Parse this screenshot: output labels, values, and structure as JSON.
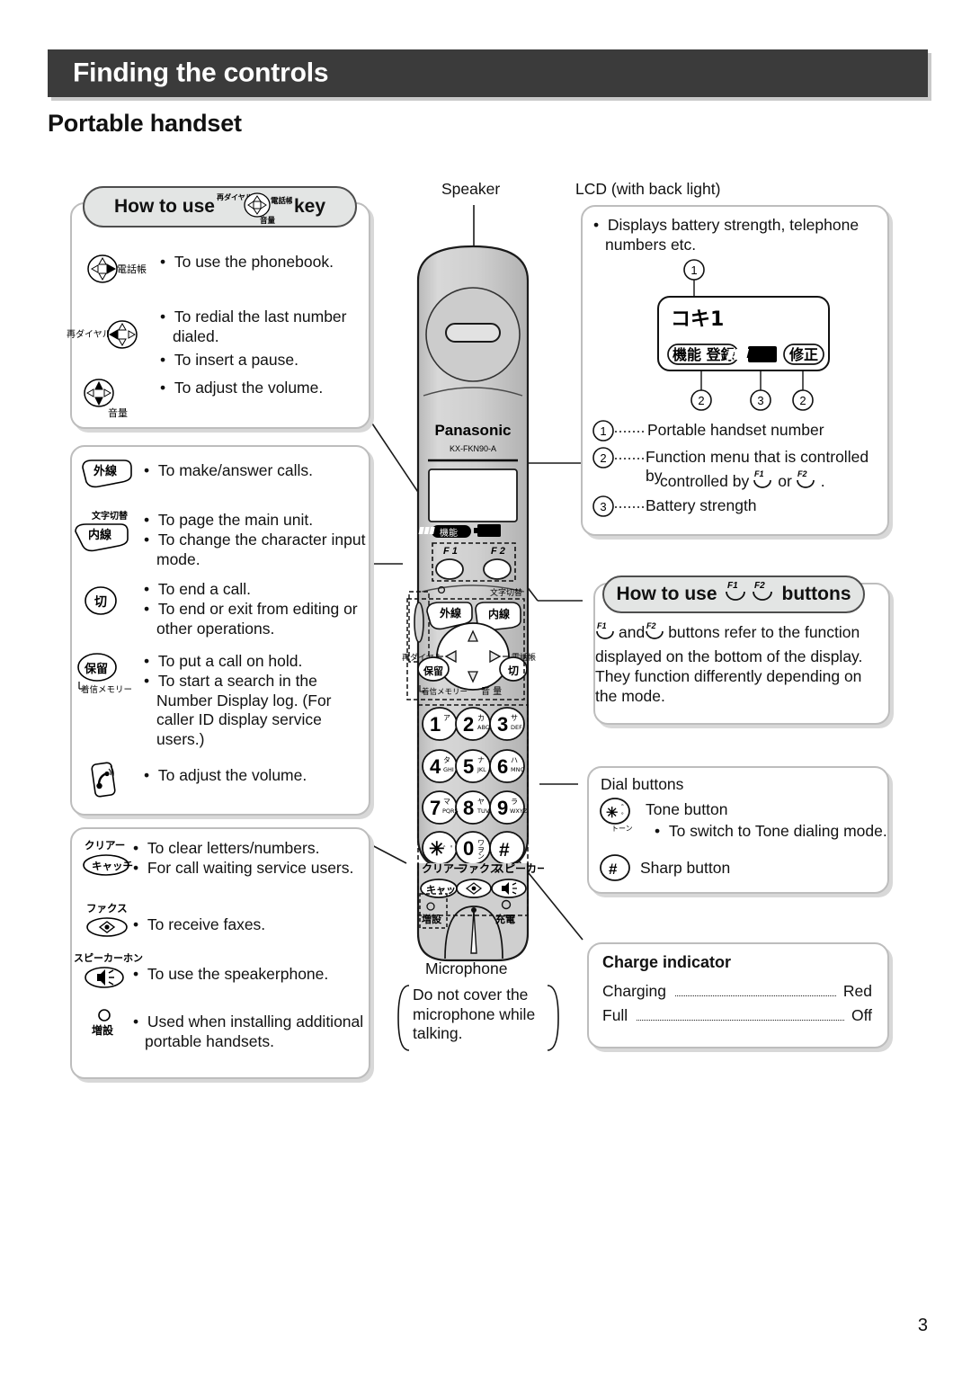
{
  "page": {
    "header_title": "Finding the controls",
    "section_title": "Portable handset",
    "page_number": "3"
  },
  "nav_key_box": {
    "pill_prefix": "How to use",
    "pill_suffix": "key",
    "pill_icon": "navigation-key-icon",
    "pill_icon_labels": {
      "left": "再ダイヤル",
      "right": "電話帳",
      "down": "音量"
    },
    "rows": [
      {
        "icon": "nav-key-right-icon",
        "icon_label": "電話帳",
        "lines": [
          "To use the phonebook."
        ]
      },
      {
        "icon": "nav-key-left-icon",
        "icon_label": "再ダイヤル",
        "lines": [
          "To redial the last number dialed.",
          "To insert a pause."
        ]
      },
      {
        "icon": "nav-key-updown-icon",
        "icon_label": "音量",
        "lines": [
          "To adjust the volume."
        ]
      }
    ]
  },
  "call_keys_box": {
    "rows": [
      {
        "icon": "talk-key-icon",
        "icon_label": "外線",
        "lines": [
          "To make/answer calls."
        ]
      },
      {
        "icon": "intercom-key-icon",
        "icon_label": "内線",
        "icon_label_top": "文字切替",
        "lines": [
          "To page the main unit.",
          "To change the character input mode."
        ]
      },
      {
        "icon": "off-key-icon",
        "icon_label": "切",
        "lines": [
          "To end a call.",
          "To end or exit from editing or other operations."
        ]
      },
      {
        "icon": "hold-key-icon",
        "icon_label": "保留",
        "icon_label_bottom": "着信メモリー",
        "lines": [
          "To put a call on hold.",
          "To start a search in the Number Display log. (For caller ID display service users.)"
        ]
      },
      {
        "icon": "receiver-volume-icon",
        "icon_label": "",
        "lines": [
          "To adjust the volume."
        ]
      }
    ]
  },
  "function_keys_box": {
    "rows": [
      {
        "icon": "catch-key-icon",
        "icon_label": "キャッチ",
        "icon_label_top": "クリアー",
        "lines": [
          "To clear letters/numbers.",
          "For call waiting service users."
        ]
      },
      {
        "icon": "fax-key-icon",
        "icon_label": "",
        "icon_label_top": "ファクス",
        "lines": [
          "To receive faxes."
        ]
      },
      {
        "icon": "speakerphone-key-icon",
        "icon_label": "",
        "icon_label_top": "スピーカーホン",
        "lines": [
          "To use the speakerphone."
        ]
      },
      {
        "icon": "extension-led-icon",
        "icon_label": "増設",
        "lines": [
          "Used when installing additional portable handsets."
        ]
      }
    ]
  },
  "speaker_label": "Speaker",
  "lcd_box": {
    "title": "LCD (with back light)",
    "bullet": "Displays battery strength, telephone numbers etc.",
    "display": {
      "handset_number_text": "コキ1",
      "softkey_left": "機能 登録",
      "battery_icon": "battery-full-icon",
      "softkey_right": "修正"
    },
    "callouts": [
      {
        "num": "1",
        "text": "Portable handset number"
      },
      {
        "num": "2",
        "text": "Function menu that is controlled by",
        "text_tail": "or",
        "text_end": ".",
        "keys": [
          "F 1",
          "F 2"
        ]
      },
      {
        "num": "3",
        "text": "Battery strength"
      }
    ],
    "marker_top": "1",
    "markers_bottom": [
      "2",
      "3",
      "2"
    ]
  },
  "fkeys_box": {
    "pill_prefix": "How to use",
    "pill_suffix": "buttons",
    "keys": [
      "F 1",
      "F 2"
    ],
    "body_lead": "and",
    "body": "buttons refer to the function displayed on the bottom of the display. They function differently depending on the mode."
  },
  "dial_box": {
    "title": "Dial buttons",
    "rows": [
      {
        "icon": "tone-key-icon",
        "icon_glyph": "✳",
        "icon_label": "トーン",
        "label": "Tone button",
        "bullets": [
          "To switch to Tone dialing mode."
        ]
      },
      {
        "icon": "sharp-key-icon",
        "icon_glyph": "#",
        "icon_label": "",
        "label": "Sharp button",
        "bullets": []
      }
    ]
  },
  "microphone": {
    "label": "Microphone",
    "note": "Do not cover the microphone while talking."
  },
  "charge_box": {
    "title": "Charge indicator",
    "rows": [
      {
        "label": "Charging",
        "value": "Red"
      },
      {
        "label": "Full",
        "value": "Off"
      }
    ]
  },
  "handset": {
    "brand": "Panasonic",
    "model": "KX-FKN90-A",
    "screen_softkey": "機能",
    "screen_battery": "battery-icon",
    "f1": "F 1",
    "f2": "F 2",
    "charmode_label": "文字切替",
    "talk_key": "外線",
    "intercom_key": "内線",
    "hold_key": "保留",
    "off_key": "切",
    "redial_label": "再ダイヤル",
    "phonebook_label": "電話帳",
    "callmemory_label": "着信メモリー",
    "volume_label": "音 量",
    "keys": [
      {
        "num": "1",
        "kana": "ア",
        "latin": ""
      },
      {
        "num": "2",
        "kana": "カ",
        "latin": "ABC"
      },
      {
        "num": "3",
        "kana": "サ",
        "latin": "DEF"
      },
      {
        "num": "4",
        "kana": "タ",
        "latin": "GHI"
      },
      {
        "num": "5",
        "kana": "ナ",
        "latin": "JKL"
      },
      {
        "num": "6",
        "kana": "ハ",
        "latin": "MNO"
      },
      {
        "num": "7",
        "kana": "マ",
        "latin": "PQRS"
      },
      {
        "num": "8",
        "kana": "ヤ",
        "latin": "TUV"
      },
      {
        "num": "9",
        "kana": "ラ",
        "latin": "WXYZ"
      },
      {
        "num": "✳",
        "kana": "゛゜",
        "latin": ""
      },
      {
        "num": "0",
        "kana": "ワヲン",
        "latin": ""
      },
      {
        "num": "#",
        "kana": "",
        "latin": ""
      }
    ],
    "tone_label": "トーン",
    "clear_label": "クリアー",
    "fax_label": "ファクス",
    "speakerphone_label": "スピーカーホン",
    "catch_label": "キャッチ",
    "extension_label": "増設",
    "charge_label": "充電"
  }
}
